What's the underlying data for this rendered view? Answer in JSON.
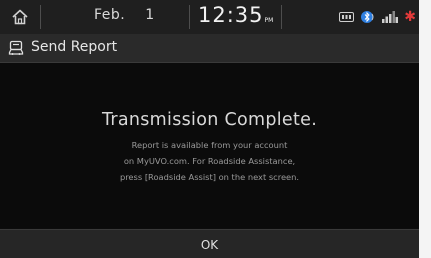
{
  "status_bar": {
    "month": "Feb.",
    "day": "1",
    "time": "12:35",
    "ampm": "PM",
    "icons": [
      "home-icon",
      "media-icon",
      "bluetooth-icon",
      "signal-icon",
      "alert-icon"
    ]
  },
  "title_bar": {
    "title": "Send Report",
    "icon": "car-report-icon"
  },
  "message": {
    "title": "Transmission Complete.",
    "line1": "Report is available from your account",
    "line2": "on MyUVO.com. For Roadside Assistance,",
    "line3": "press [Roadside Assist] on the next screen."
  },
  "ok_button": {
    "label": "OK"
  },
  "colors": {
    "background": "#0b0b0b",
    "status_bar": "#1f1f1f",
    "title_bar": "#2a2a2a",
    "alert": "#e23a3a"
  }
}
